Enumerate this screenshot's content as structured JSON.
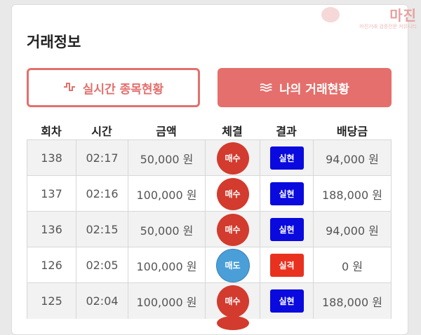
{
  "page": {
    "title": "거래정보",
    "watermark_text": "마진",
    "watermark_subtext": "마진거래 검증전문 커뮤니티"
  },
  "buttons": {
    "live": {
      "label": "실시간 종목현황",
      "icon": "pulse-icon"
    },
    "mine": {
      "label": "나의 거래현황",
      "icon": "menu-lines-icon"
    }
  },
  "table": {
    "headers": [
      "회차",
      "시간",
      "금액",
      "체결",
      "결과",
      "배당금"
    ],
    "rows": [
      {
        "round": "138",
        "time": "02:17",
        "amount": "50,000 원",
        "trade": "매수",
        "result": "실현",
        "payout": "94,000 원"
      },
      {
        "round": "137",
        "time": "02:16",
        "amount": "100,000 원",
        "trade": "매수",
        "result": "실현",
        "payout": "188,000 원"
      },
      {
        "round": "136",
        "time": "02:15",
        "amount": "50,000 원",
        "trade": "매수",
        "result": "실현",
        "payout": "94,000 원"
      },
      {
        "round": "126",
        "time": "02:05",
        "amount": "100,000 원",
        "trade": "매도",
        "result": "실격",
        "payout": "0 원"
      },
      {
        "round": "125",
        "time": "02:04",
        "amount": "100,000 원",
        "trade": "매수",
        "result": "실현",
        "payout": "188,000 원"
      }
    ]
  },
  "colors": {
    "accent": "#e46f6c",
    "buy": "#d23b2e",
    "sell": "#4a9fd8",
    "success": "#0a0adf",
    "fail": "#e8321f"
  }
}
